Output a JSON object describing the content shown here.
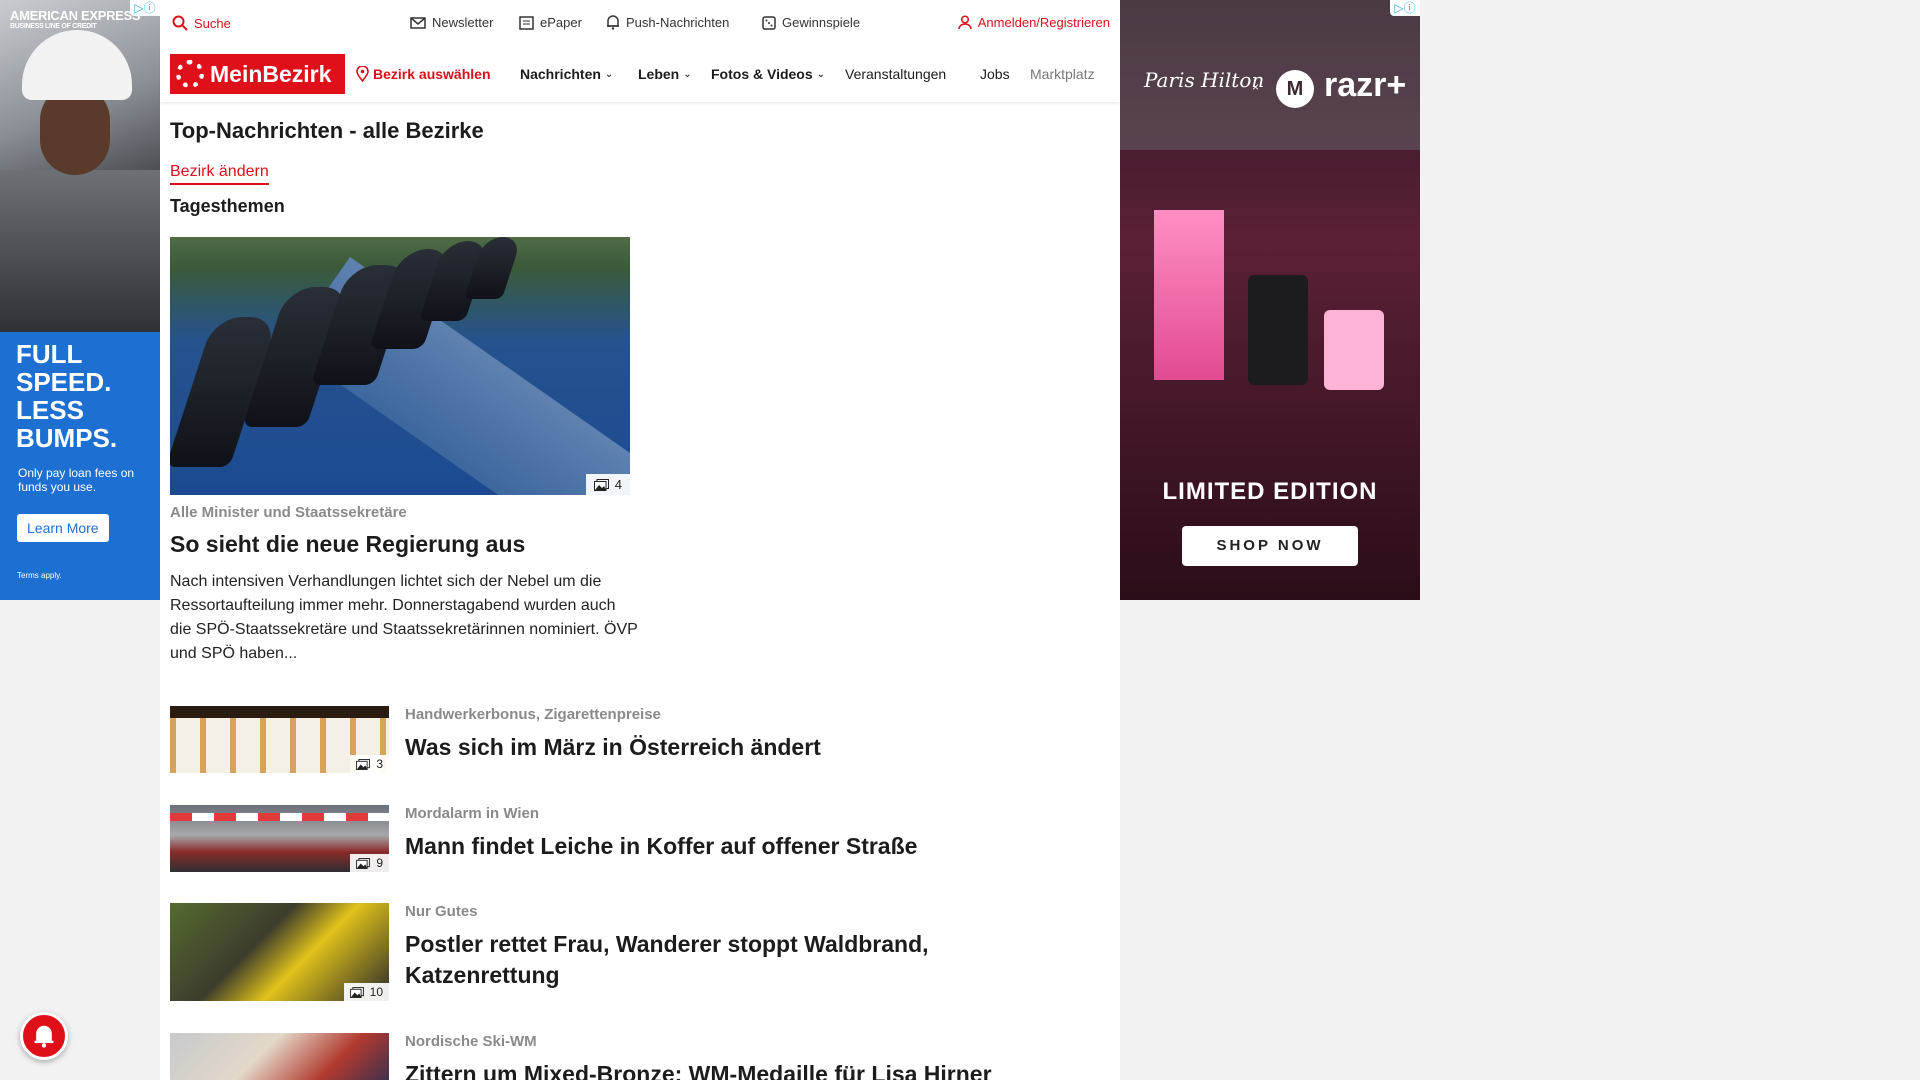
{
  "ads": {
    "left": {
      "brand": "AMERICAN EXPRESS",
      "brand_sub": "BUSINESS LINE OF CREDIT",
      "headline": "FULL SPEED. LESS BUMPS.",
      "subtext": "Only pay loan fees on funds you use.",
      "cta": "Learn More",
      "terms": "Terms apply.",
      "color": "#1d6fd1"
    },
    "right": {
      "signature": "Paris Hilton",
      "x": "×",
      "brand": "razr+",
      "headline": "LIMITED EDITION",
      "cta": "SHOP NOW"
    }
  },
  "topbar": {
    "search": "Suche",
    "newsletter": "Newsletter",
    "epaper": "ePaper",
    "push": "Push-Nachrichten",
    "gewinnspiele": "Gewinnspiele",
    "login": "Anmelden/Registrieren"
  },
  "nav": {
    "logo": "MeinBezirk",
    "bezirk": "Bezirk auswählen",
    "items": [
      {
        "label": "Nachrichten"
      },
      {
        "label": "Leben"
      },
      {
        "label": "Fotos & Videos"
      },
      {
        "label": "Veranstaltungen"
      },
      {
        "label": "Jobs"
      },
      {
        "label": "Marktplatz"
      }
    ]
  },
  "main": {
    "section_title": "Top-Nachrichten - alle Bezirke",
    "change_link": "Bezirk ändern",
    "subhead": "Tagesthemen",
    "hero": {
      "kicker": "Alle Minister und Staatssekretäre",
      "title": "So sieht die neue Regierung aus",
      "text": "Nach intensiven Verhandlungen lichtet sich der Nebel um die Ressortaufteilung immer mehr. Donnerstagabend wurden auch die SPÖ-Staatssekretäre und Staatssekretärinnen nominiert. ÖVP und SPÖ haben...",
      "image_count": "4"
    },
    "articles": [
      {
        "kicker": "Handwerkerbonus, Zigarettenpreise",
        "title": "Was sich im März in Österreich ändert",
        "count": "3"
      },
      {
        "kicker": "Mordalarm in Wien",
        "title": "Mann findet Leiche in Koffer auf offener Straße",
        "count": "9"
      },
      {
        "kicker": "Nur Gutes",
        "title": "Postler rettet Frau, Wanderer stoppt Waldbrand, Katzenrettung",
        "count": "10"
      },
      {
        "kicker": "Nordische Ski-WM",
        "title": "Zittern um Mixed-Bronze: WM-Medaille für Lisa Hirner",
        "count": ""
      }
    ]
  },
  "colors": {
    "brand_red": "#e0101b",
    "link_red": "#d8121c",
    "kicker_gray": "#8a8a8a"
  }
}
